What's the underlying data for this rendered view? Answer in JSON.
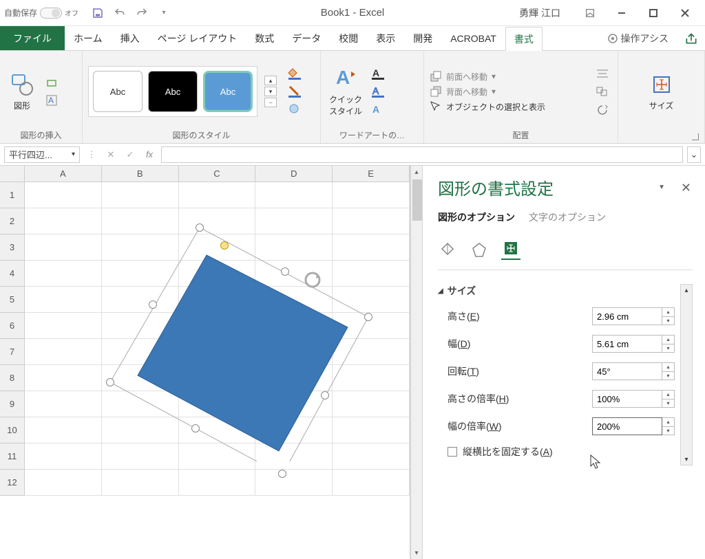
{
  "titlebar": {
    "autosave_label": "自動保存",
    "autosave_state": "オフ",
    "doc_title": "Book1 - Excel",
    "username": "勇輝 江口"
  },
  "tabs": {
    "file": "ファイル",
    "home": "ホーム",
    "insert": "挿入",
    "pagelayout": "ページ レイアウト",
    "formulas": "数式",
    "data": "データ",
    "review": "校閲",
    "view": "表示",
    "developer": "開発",
    "acrobat": "ACROBAT",
    "format": "書式",
    "tellme": "操作アシス"
  },
  "ribbon": {
    "insert_shapes_group": "図形の挿入",
    "shapes_btn": "図形",
    "shape_styles_group": "図形のスタイル",
    "style_abc": "Abc",
    "quick_style": "クイック\nスタイル",
    "wordart_group": "ワードアートの…",
    "arrange_group": "配置",
    "bring_forward": "前面へ移動",
    "send_backward": "背面へ移動",
    "selection_pane": "オブジェクトの選択と表示",
    "size_group": "サイズ",
    "size_btn": "サイズ"
  },
  "formula_bar": {
    "namebox": "平行四辺..."
  },
  "sheet": {
    "cols": [
      "A",
      "B",
      "C",
      "D",
      "E"
    ],
    "rows": [
      "1",
      "2",
      "3",
      "4",
      "5",
      "6",
      "7",
      "8",
      "9",
      "10",
      "11",
      "12"
    ]
  },
  "pane": {
    "title": "図形の書式設定",
    "tab_shape": "図形のオプション",
    "tab_text": "文字のオプション",
    "section_size": "サイズ",
    "height_label": "高さ(E)",
    "height_value": "2.96 cm",
    "width_label": "幅(D)",
    "width_value": "5.61 cm",
    "rotation_label": "回転(T)",
    "rotation_value": "45°",
    "scale_h_label": "高さの倍率(H)",
    "scale_h_value": "100%",
    "scale_w_label": "幅の倍率(W)",
    "scale_w_value": "200%",
    "lock_aspect": "縦横比を固定する(A)"
  }
}
